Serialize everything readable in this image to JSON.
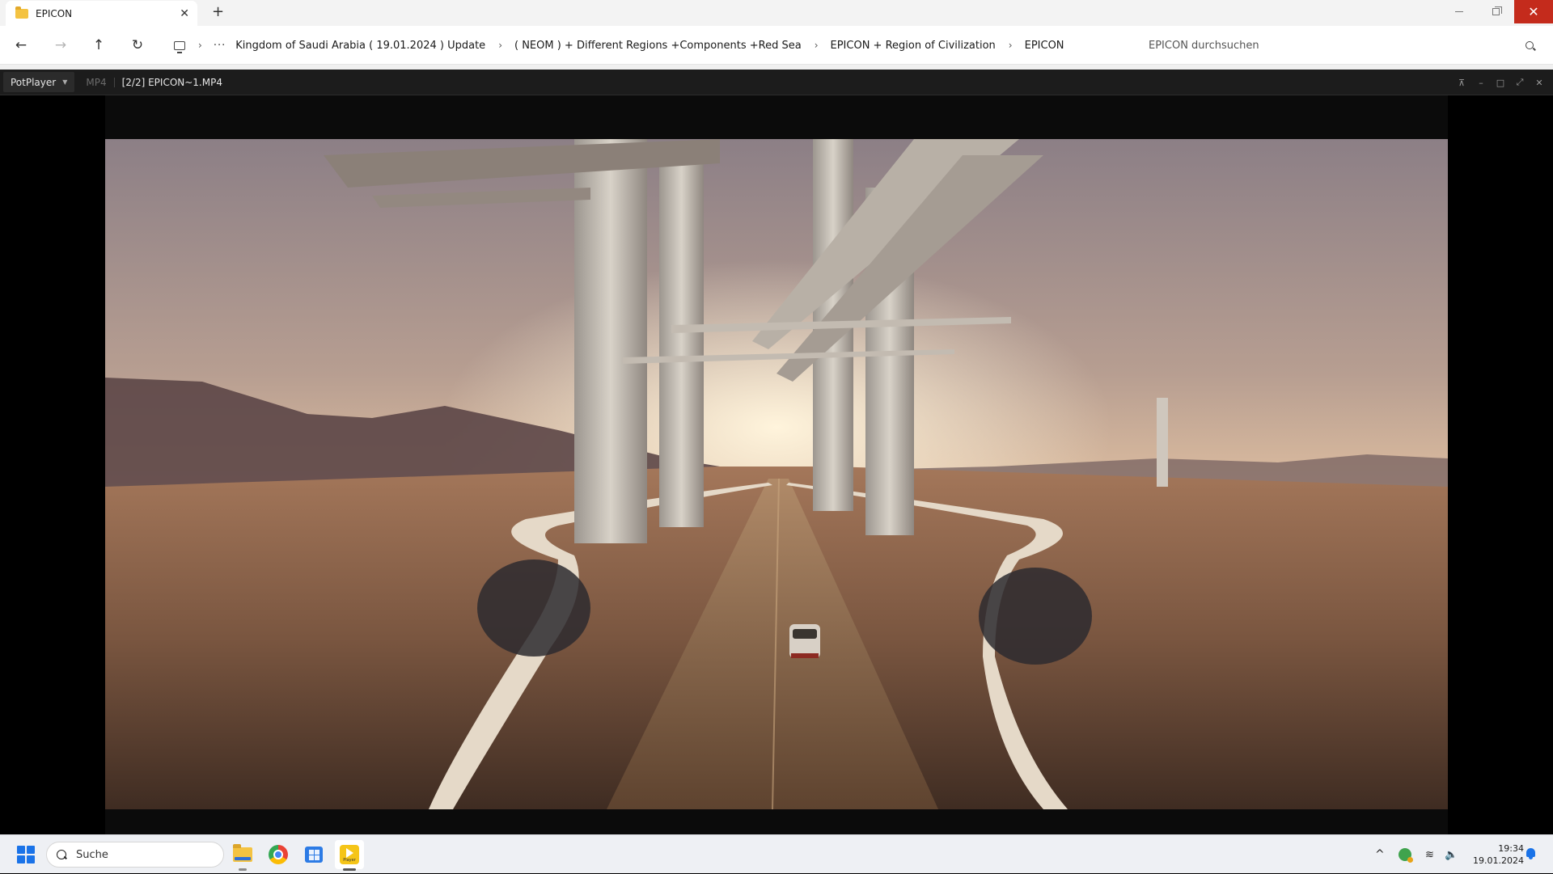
{
  "explorer": {
    "tab_title": "EPICON",
    "tab_close_glyph": "✕",
    "new_tab_glyph": "+",
    "nav": {
      "back_glyph": "←",
      "forward_glyph": "→",
      "up_glyph": "↑",
      "refresh_glyph": "↻"
    },
    "breadcrumb": {
      "more_glyph": "···",
      "separator_glyph": "›",
      "items": [
        "Kingdom of Saudi Arabia ( 19.01.2024 ) Update",
        "( NEOM ) + Different Regions +Components +Red Sea",
        "EPICON + Region of Civilization",
        "EPICON"
      ]
    },
    "search_placeholder": "EPICON durchsuchen",
    "window_close_glyph": "✕"
  },
  "player": {
    "menu_label": "PotPlayer",
    "menu_caret": "▼",
    "format": "MP4",
    "file_title": "[2/2] EPICON~1.MP4",
    "controls": {
      "pin_glyph": "⊼",
      "minimize_glyph": "–",
      "maximize_glyph": "□",
      "fullscreen_glyph": "⤢",
      "close_glyph": "✕"
    }
  },
  "taskbar": {
    "search_label": "Suche",
    "tray_caret_glyph": "^",
    "wifi_glyph": "≋",
    "volume_glyph": "🔈",
    "time": "19:34",
    "date": "19.01.2024",
    "potplayer_icon_text": "Player"
  },
  "colors": {
    "close_button": "#c42b1c",
    "potplayer_bar": "#1c1c1c",
    "windows_accent": "#1a73e8",
    "potplayer_yellow": "#f5c518"
  }
}
